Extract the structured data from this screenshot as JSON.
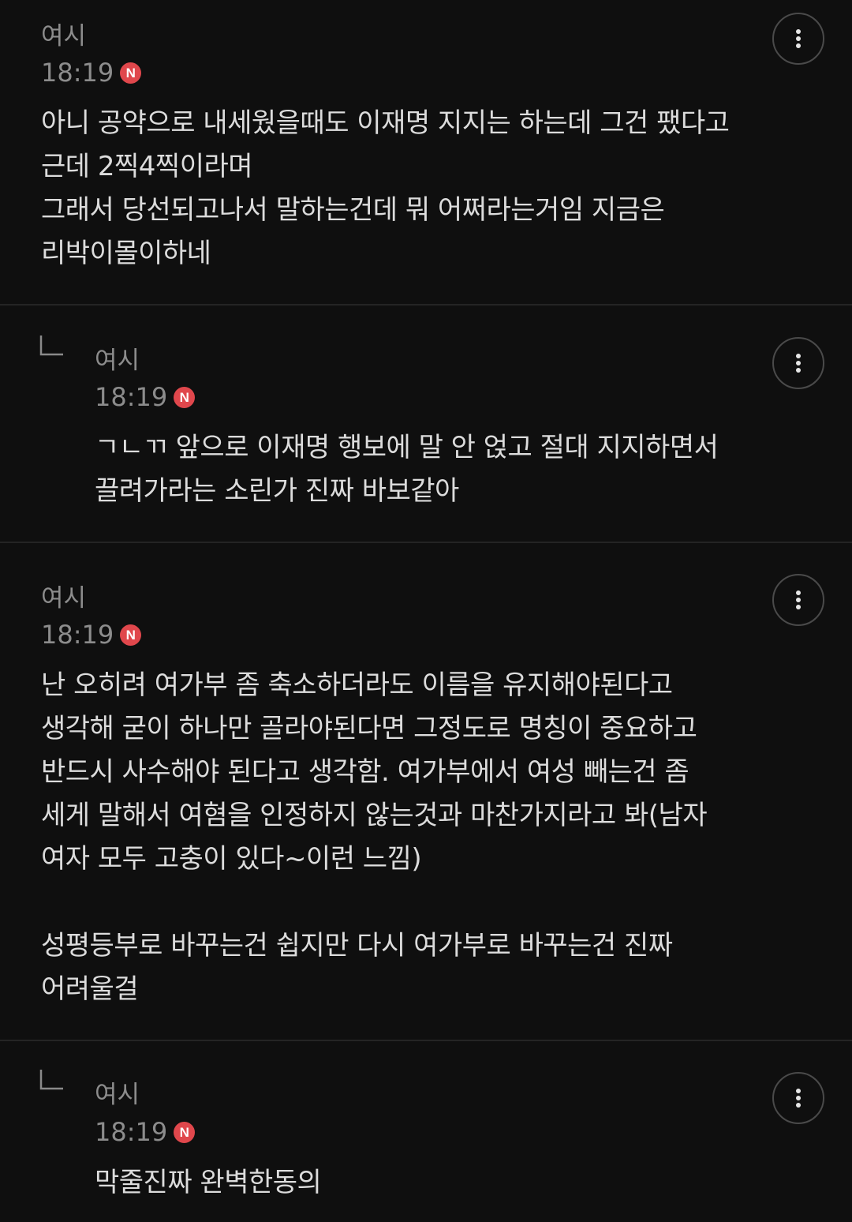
{
  "comments": [
    {
      "author": "여시",
      "time": "18:19",
      "badge": "N",
      "is_reply": false,
      "text": "아니 공약으로 내세웠을때도 이재명 지지는 하는데 그건 팼다고\n근데 2찍4찍이라며\n그래서 당선되고나서 말하는건데 뭐 어쩌라는거임 지금은\n리박이몰이하네"
    },
    {
      "author": "여시",
      "time": "18:19",
      "badge": "N",
      "is_reply": true,
      "text": "ㄱㄴㄲ 앞으로 이재명 행보에 말 안 얹고 절대 지지하면서\n끌려가라는 소린가 진짜 바보같아"
    },
    {
      "author": "여시",
      "time": "18:19",
      "badge": "N",
      "is_reply": false,
      "text": "난 오히려 여가부 좀 축소하더라도 이름을 유지해야된다고\n생각해 굳이 하나만 골라야된다면 그정도로 명칭이 중요하고\n반드시 사수해야 된다고 생각함. 여가부에서 여성 빼는건 좀\n세게 말해서 여혐을 인정하지 않는것과 마찬가지라고 봐(남자\n여자 모두 고충이 있다~이런 느낌)\n\n성평등부로 바꾸는건 쉽지만 다시 여가부로 바꾸는건 진짜\n어려울걸"
    },
    {
      "author": "여시",
      "time": "18:19",
      "badge": "N",
      "is_reply": true,
      "text": "막줄진짜 완벽한동의"
    }
  ],
  "icons": {
    "more": "more-vertical-icon",
    "reply": "reply-arrow-icon"
  },
  "colors": {
    "background": "#0f0f0f",
    "text": "#dcdcdc",
    "meta": "#8c8c8c",
    "badge": "#e0474c",
    "divider": "#242424"
  }
}
